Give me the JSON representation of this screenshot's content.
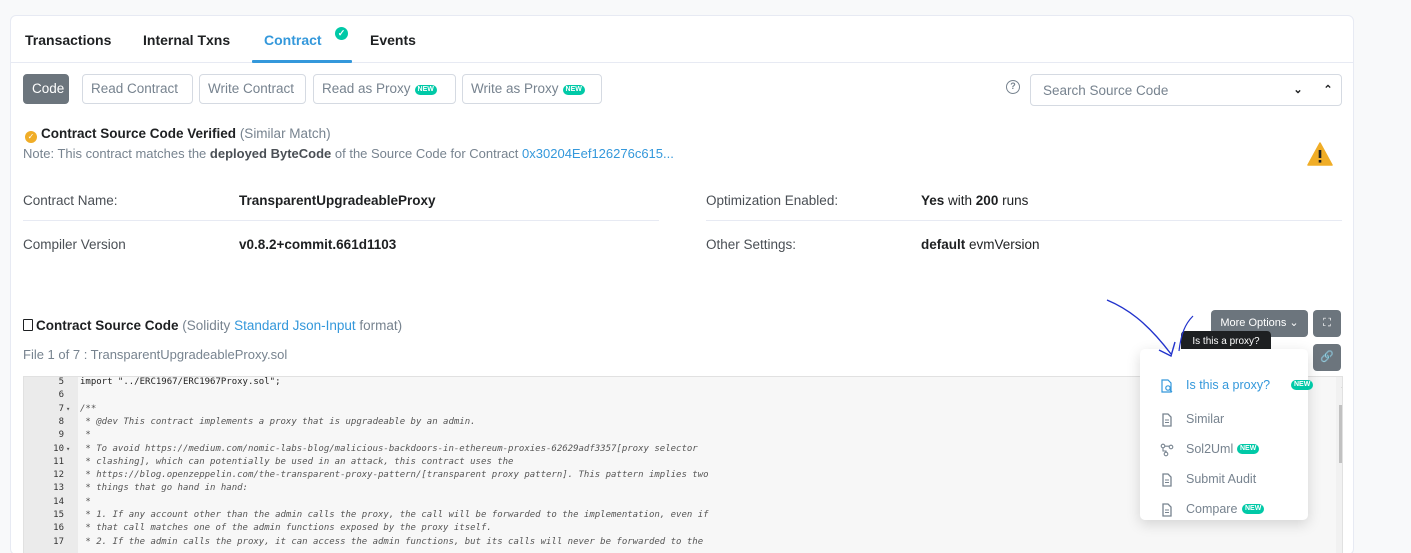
{
  "tabs": [
    {
      "label": "Transactions"
    },
    {
      "label": "Internal Txns"
    },
    {
      "label": "Contract",
      "active": true,
      "verified_icon": "check-circle-icon"
    },
    {
      "label": "Events"
    }
  ],
  "subtabs": {
    "code": "Code",
    "read_contract": "Read Contract",
    "write_contract": "Write Contract",
    "read_proxy": "Read as Proxy",
    "write_proxy": "Write as Proxy",
    "new_badge": "NEW"
  },
  "search": {
    "placeholder": "Search Source Code"
  },
  "verified": {
    "title": "Contract Source Code Verified",
    "match": "(Similar Match)",
    "note_prefix": "Note: This contract matches the ",
    "note_bold": "deployed ByteCode",
    "note_middle": " of the Source Code for Contract ",
    "note_link": "0x30204Eef126276c615..."
  },
  "info": {
    "contract_name_label": "Contract Name:",
    "contract_name": "TransparentUpgradeableProxy",
    "compiler_label": "Compiler Version",
    "compiler": "v0.8.2+commit.661d1103",
    "optimization_label": "Optimization Enabled:",
    "optimization_yes": "Yes",
    "optimization_with": " with ",
    "optimization_runs": "200",
    "optimization_suffix": " runs",
    "other_label": "Other Settings:",
    "other_bold": "default",
    "other_rest": " evmVersion"
  },
  "source": {
    "title": "Contract Source Code",
    "paren_open": "(Solidity ",
    "link": "Standard Json-Input",
    "paren_close": " format)",
    "file": "File 1 of 7 : TransparentUpgradeableProxy.sol",
    "more_options": "More Options",
    "tooltip": "Is this a proxy?"
  },
  "code_lines": [
    {
      "n": "5",
      "fold": "",
      "text": "import \"../ERC1967/ERC1967Proxy.sol\";",
      "plain": true
    },
    {
      "n": "6",
      "fold": "",
      "text": ""
    },
    {
      "n": "7",
      "fold": "▾",
      "text": "/**"
    },
    {
      "n": "8",
      "fold": "",
      "text": " * @dev This contract implements a proxy that is upgradeable by an admin."
    },
    {
      "n": "9",
      "fold": "",
      "text": " *"
    },
    {
      "n": "10",
      "fold": "▾",
      "text": " * To avoid https://medium.com/nomic-labs-blog/malicious-backdoors-in-ethereum-proxies-62629adf3357[proxy selector"
    },
    {
      "n": "11",
      "fold": "",
      "text": " * clashing], which can potentially be used in an attack, this contract uses the"
    },
    {
      "n": "12",
      "fold": "",
      "text": " * https://blog.openzeppelin.com/the-transparent-proxy-pattern/[transparent proxy pattern]. This pattern implies two"
    },
    {
      "n": "13",
      "fold": "",
      "text": " * things that go hand in hand:"
    },
    {
      "n": "14",
      "fold": "",
      "text": " *"
    },
    {
      "n": "15",
      "fold": "",
      "text": " * 1. If any account other than the admin calls the proxy, the call will be forwarded to the implementation, even if"
    },
    {
      "n": "16",
      "fold": "",
      "text": " * that call matches one of the admin functions exposed by the proxy itself."
    },
    {
      "n": "17",
      "fold": "",
      "text": " * 2. If the admin calls the proxy, it can access the admin functions, but its calls will never be forwarded to the"
    }
  ],
  "menu": [
    {
      "label": "Is this a proxy?",
      "icon": "proxy-search-icon",
      "new": true,
      "highlight": true
    },
    {
      "label": "Similar",
      "icon": "document-icon",
      "new": false
    },
    {
      "label": "Sol2Uml",
      "icon": "diagram-icon",
      "new": true
    },
    {
      "label": "Submit Audit",
      "icon": "document-icon",
      "new": false
    },
    {
      "label": "Compare",
      "icon": "document-icon",
      "new": true
    }
  ],
  "colors": {
    "accent": "#3498db",
    "new_badge": "#00c9a7",
    "warning": "#f0ad27",
    "button_dark": "#6c757d"
  }
}
